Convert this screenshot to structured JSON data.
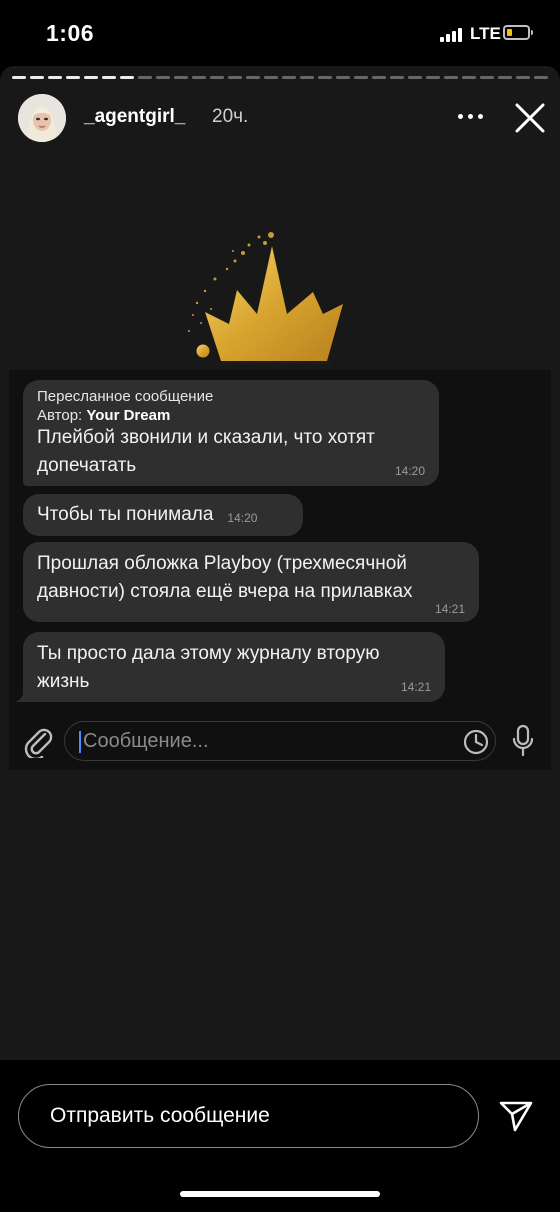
{
  "status_bar": {
    "time": "1:06",
    "network": "LTE",
    "battery_color": "#f2c200"
  },
  "story": {
    "username": "_agentgirl_",
    "time_ago": "20ч.",
    "segments_total": 30,
    "segments_done": 7,
    "icons": {
      "more": "more-horizontal-icon",
      "close": "close-icon",
      "crown": "crown-image"
    }
  },
  "chat": {
    "messages": [
      {
        "forwarded_title": "Пересланное сообщение",
        "author_label": "Автор:",
        "author_name": "Your Dream",
        "lines": [
          "Плейбой звонили и сказали, что хотят",
          "допечатать"
        ],
        "time": "14:20"
      },
      {
        "lines": [
          "Чтобы ты понимала"
        ],
        "time": "14:20"
      },
      {
        "lines": [
          "Прошлая обложка Playboy (трехмесячной",
          "давности) стояла ещё вчера на прилавках"
        ],
        "time": "14:21"
      },
      {
        "lines": [
          "Ты просто дала этому журналу вторую",
          "жизнь"
        ],
        "time": "14:21"
      }
    ],
    "composer": {
      "placeholder": "Сообщение...",
      "icons": {
        "attach": "paperclip-icon",
        "sticker": "clock-icon",
        "mic": "microphone-icon"
      }
    }
  },
  "reply": {
    "placeholder": "Отправить сообщение",
    "send_icon": "send-icon"
  },
  "colors": {
    "accent_caret": "#4a8cff",
    "bubble": "#2f2f2f",
    "crown_gold": "#e3b23c"
  }
}
